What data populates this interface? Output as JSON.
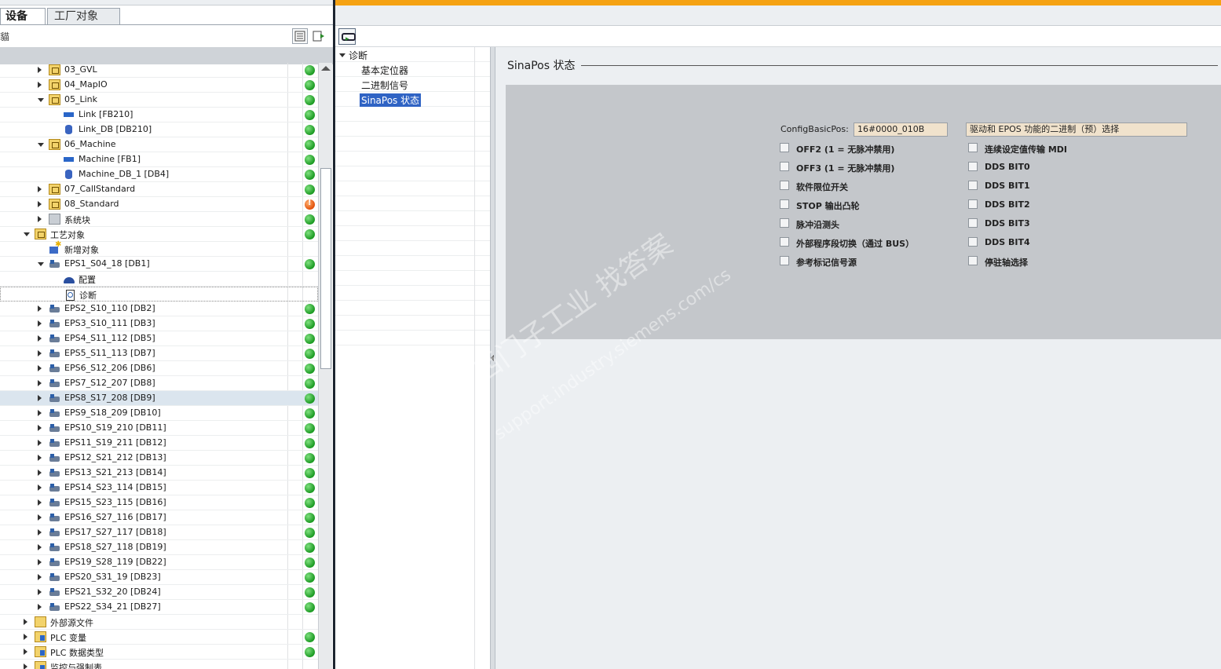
{
  "left_panel": {
    "tabs": [
      {
        "label": "设备"
      },
      {
        "label": "工厂对象"
      }
    ],
    "toolbar_cut_text": "貓",
    "tree": [
      {
        "label": "03_GVL",
        "icon": "folder-icon",
        "expand": "right",
        "status": "ok",
        "indent": 1
      },
      {
        "label": "04_MapIO",
        "icon": "folder-icon",
        "expand": "right",
        "status": "ok",
        "indent": 1
      },
      {
        "label": "05_Link",
        "icon": "folder-icon",
        "expand": "down",
        "status": "ok",
        "indent": 1
      },
      {
        "label": "Link [FB210]",
        "icon": "function-block-icon",
        "expand": "",
        "status": "ok",
        "indent": 2
      },
      {
        "label": "Link_DB [DB210]",
        "icon": "data-block-icon",
        "expand": "",
        "status": "ok",
        "indent": 2
      },
      {
        "label": "06_Machine",
        "icon": "folder-icon",
        "expand": "down",
        "status": "ok",
        "indent": 1
      },
      {
        "label": "Machine [FB1]",
        "icon": "function-block-icon",
        "expand": "",
        "status": "ok",
        "indent": 2
      },
      {
        "label": "Machine_DB_1 [DB4]",
        "icon": "data-block-icon",
        "expand": "",
        "status": "ok",
        "indent": 2
      },
      {
        "label": "07_CallStandard",
        "icon": "folder-icon",
        "expand": "right",
        "status": "ok",
        "indent": 1
      },
      {
        "label": "08_Standard",
        "icon": "folder-icon",
        "expand": "right",
        "status": "warn",
        "indent": 1
      },
      {
        "label": "系统块",
        "icon": "system-block-icon",
        "expand": "right",
        "status": "ok",
        "indent": 1
      },
      {
        "label": "工艺对象",
        "icon": "folder-icon",
        "expand": "down",
        "status": "ok",
        "indent": 0
      },
      {
        "label": "新增对象",
        "icon": "new-object-icon",
        "expand": "",
        "status": "",
        "indent": 1
      },
      {
        "label": "EPS1_S04_18 [DB1]",
        "icon": "technology-object-icon",
        "expand": "down",
        "status": "ok",
        "indent": 1
      },
      {
        "label": "配置",
        "icon": "configuration-icon",
        "expand": "",
        "status": "",
        "indent": 2
      },
      {
        "label": "诊断",
        "icon": "diagnostics-icon",
        "expand": "",
        "status": "",
        "indent": 2,
        "focused": true
      },
      {
        "label": "EPS2_S10_110 [DB2]",
        "icon": "technology-object-icon",
        "expand": "right",
        "status": "ok",
        "indent": 1
      },
      {
        "label": "EPS3_S10_111 [DB3]",
        "icon": "technology-object-icon",
        "expand": "right",
        "status": "ok",
        "indent": 1
      },
      {
        "label": "EPS4_S11_112 [DB5]",
        "icon": "technology-object-icon",
        "expand": "right",
        "status": "ok",
        "indent": 1
      },
      {
        "label": "EPS5_S11_113 [DB7]",
        "icon": "technology-object-icon",
        "expand": "right",
        "status": "ok",
        "indent": 1
      },
      {
        "label": "EPS6_S12_206 [DB6]",
        "icon": "technology-object-icon",
        "expand": "right",
        "status": "ok",
        "indent": 1
      },
      {
        "label": "EPS7_S12_207 [DB8]",
        "icon": "technology-object-icon",
        "expand": "right",
        "status": "ok",
        "indent": 1
      },
      {
        "label": "EPS8_S17_208 [DB9]",
        "icon": "technology-object-icon",
        "expand": "right",
        "status": "ok",
        "indent": 1,
        "selected": true
      },
      {
        "label": "EPS9_S18_209 [DB10]",
        "icon": "technology-object-icon",
        "expand": "right",
        "status": "ok",
        "indent": 1
      },
      {
        "label": "EPS10_S19_210 [DB11]",
        "icon": "technology-object-icon",
        "expand": "right",
        "status": "ok",
        "indent": 1
      },
      {
        "label": "EPS11_S19_211 [DB12]",
        "icon": "technology-object-icon",
        "expand": "right",
        "status": "ok",
        "indent": 1
      },
      {
        "label": "EPS12_S21_212 [DB13]",
        "icon": "technology-object-icon",
        "expand": "right",
        "status": "ok",
        "indent": 1
      },
      {
        "label": "EPS13_S21_213 [DB14]",
        "icon": "technology-object-icon",
        "expand": "right",
        "status": "ok",
        "indent": 1
      },
      {
        "label": "EPS14_S23_114 [DB15]",
        "icon": "technology-object-icon",
        "expand": "right",
        "status": "ok",
        "indent": 1
      },
      {
        "label": "EPS15_S23_115 [DB16]",
        "icon": "technology-object-icon",
        "expand": "right",
        "status": "ok",
        "indent": 1
      },
      {
        "label": "EPS16_S27_116 [DB17]",
        "icon": "technology-object-icon",
        "expand": "right",
        "status": "ok",
        "indent": 1
      },
      {
        "label": "EPS17_S27_117 [DB18]",
        "icon": "technology-object-icon",
        "expand": "right",
        "status": "ok",
        "indent": 1
      },
      {
        "label": "EPS18_S27_118 [DB19]",
        "icon": "technology-object-icon",
        "expand": "right",
        "status": "ok",
        "indent": 1
      },
      {
        "label": "EPS19_S28_119 [DB22]",
        "icon": "technology-object-icon",
        "expand": "right",
        "status": "ok",
        "indent": 1
      },
      {
        "label": "EPS20_S31_19 [DB23]",
        "icon": "technology-object-icon",
        "expand": "right",
        "status": "ok",
        "indent": 1
      },
      {
        "label": "EPS21_S32_20 [DB24]",
        "icon": "technology-object-icon",
        "expand": "right",
        "status": "ok",
        "indent": 1
      },
      {
        "label": "EPS22_S34_21 [DB27]",
        "icon": "technology-object-icon",
        "expand": "right",
        "status": "ok",
        "indent": 1
      },
      {
        "label": "外部源文件",
        "icon": "external-source-icon",
        "expand": "right",
        "status": "",
        "indent": 0
      },
      {
        "label": "PLC 变量",
        "icon": "plc-tags-icon",
        "expand": "right",
        "status": "ok",
        "indent": 0
      },
      {
        "label": "PLC 数据类型",
        "icon": "plc-datatype-icon",
        "expand": "right",
        "status": "ok",
        "indent": 0
      },
      {
        "label": "监控与强制表",
        "icon": "watch-table-icon",
        "expand": "right",
        "status": "",
        "indent": 0
      }
    ]
  },
  "nav": {
    "root": "诊断",
    "items": [
      "基本定位器",
      "二进制信号",
      "SinaPos 状态"
    ],
    "selected_index": 2
  },
  "content": {
    "section_title": "SinaPos 状态",
    "config_label": "ConfigBasicPos:",
    "config_value": "16#0000_010B",
    "right_field_value": "驱动和 EPOS 功能的二进制（预）选择",
    "left_checks": [
      "OFF2 (1 = 无脉冲禁用)",
      "OFF3 (1 = 无脉冲禁用)",
      "软件限位开关",
      "STOP 输出凸轮",
      "脉冲沿测头",
      "外部程序段切换（通过 BUS）",
      "参考标记信号源"
    ],
    "right_checks": [
      "连续设定值传输 MDI",
      "DDS BIT0",
      "DDS BIT1",
      "DDS BIT2",
      "DDS BIT3",
      "DDS BIT4",
      "停驻轴选择"
    ]
  },
  "watermark": {
    "line1": "西门子工业  找答案",
    "line2": "support.industry.siemens.com/cs"
  }
}
